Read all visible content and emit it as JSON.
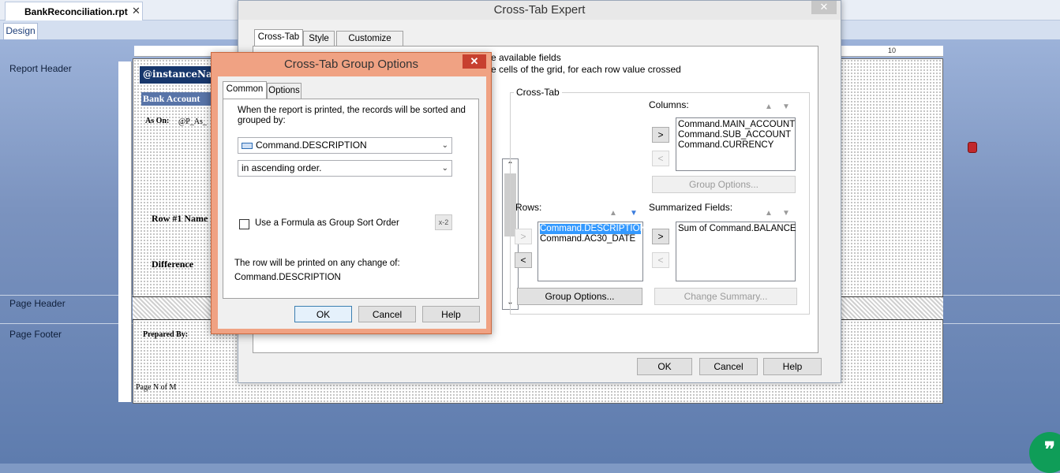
{
  "designer": {
    "file_tab": "BankReconciliation.rpt",
    "close_glyph": "✕",
    "view_tab": "Design",
    "sections": [
      "Report Header",
      "Page Header",
      "Page Footer"
    ],
    "report_fields": {
      "instance_name": "@instanceNam",
      "bank_account": "Bank Account",
      "as_on": "As On:",
      "as_on_value": "@P_As_",
      "row1": "Row #1 Name",
      "difference": "Difference",
      "prepared_by": "Prepared By:",
      "page_n_of_m": "Page N of M"
    },
    "ruler_mark": "10",
    "chat_glyph": "❞"
  },
  "expert": {
    "title": "Cross-Tab Expert",
    "tabs": [
      "Cross-Tab",
      "Style",
      "Customize Style"
    ],
    "hint1": "e available fields",
    "hint2": "e cells of the grid, for each row value crossed",
    "group_label": "Cross-Tab",
    "columns_label": "Columns:",
    "columns": [
      "Command.MAIN_ACCOUNT",
      "Command.SUB_ACCOUNT",
      "Command.CURRENCY"
    ],
    "rows_label": "Rows:",
    "rows": [
      "Command.DESCRIPTION",
      "Command.AC30_DATE"
    ],
    "summarized_label": "Summarized Fields:",
    "summarized": [
      "Sum of Command.BALANCE"
    ],
    "group_options_cols": "Group Options...",
    "group_options_rows": "Group Options...",
    "change_summary": "Change Summary...",
    "ok": "OK",
    "cancel": "Cancel",
    "help": "Help",
    "arrow_right": ">",
    "arrow_left": "<"
  },
  "group_options": {
    "title": "Cross-Tab Group Options",
    "tabs": [
      "Common",
      "Options"
    ],
    "sort_desc": "When the report is printed, the records will be sorted and grouped by:",
    "field": "Command.DESCRIPTION",
    "order": "in ascending order.",
    "formula_checkbox": "Use a Formula as Group Sort Order",
    "formula_icon": "x-2",
    "change_desc": "The row will be printed on any change of:",
    "change_field": "Command.DESCRIPTION",
    "ok": "OK",
    "cancel": "Cancel",
    "help": "Help"
  }
}
